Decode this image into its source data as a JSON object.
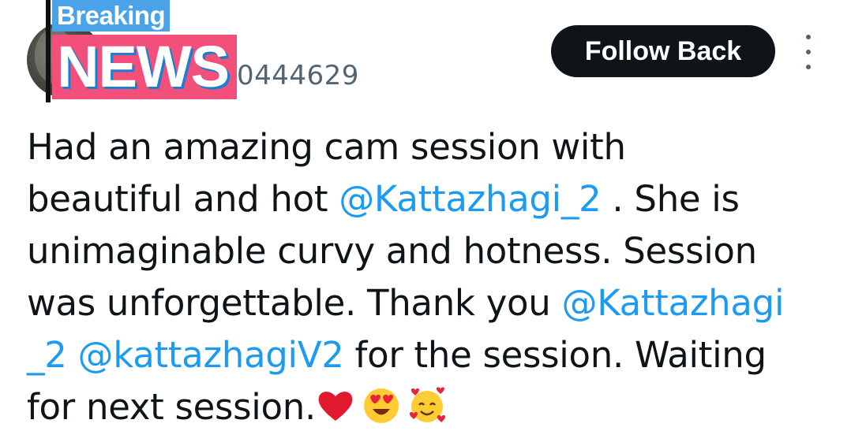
{
  "tweet": {
    "handle_visible": "0444629",
    "name_visible": "",
    "follow_label": "Follow Back",
    "text_lines": [
      {
        "parts": [
          {
            "text": "Had an amazing cam session with",
            "mention": false
          }
        ]
      },
      {
        "parts": [
          {
            "text": "beautiful and hot ",
            "mention": false
          },
          {
            "text": "@Kattazhagi_2",
            "mention": true
          },
          {
            "text": " . She is",
            "mention": false
          }
        ]
      },
      {
        "parts": [
          {
            "text": "unimaginable curvy and hotness. Session",
            "mention": false
          }
        ]
      },
      {
        "parts": [
          {
            "text": "was unforgettable. Thank you ",
            "mention": false
          },
          {
            "text": "@Kattazhagi",
            "mention": true
          }
        ]
      },
      {
        "parts": [
          {
            "text": "_2 @kattazhagiV2",
            "mention": true
          },
          {
            "text": "  for the session. Waiting",
            "mention": false
          }
        ]
      },
      {
        "parts": [
          {
            "text": "for next session.",
            "mention": false
          }
        ]
      }
    ],
    "emojis": [
      "red-heart-icon",
      "heart-eyes-face-icon",
      "smiling-face-with-hearts-icon"
    ]
  },
  "sticker": {
    "top_text": "Breaking",
    "bottom_text": "NEWS"
  },
  "colors": {
    "text": "#0f1419",
    "secondary": "#536471",
    "mention": "#1d9bf0",
    "button_bg": "#0f1419",
    "breaking_bg": "#4aa3e8",
    "news_bg": "#f24f7a"
  }
}
